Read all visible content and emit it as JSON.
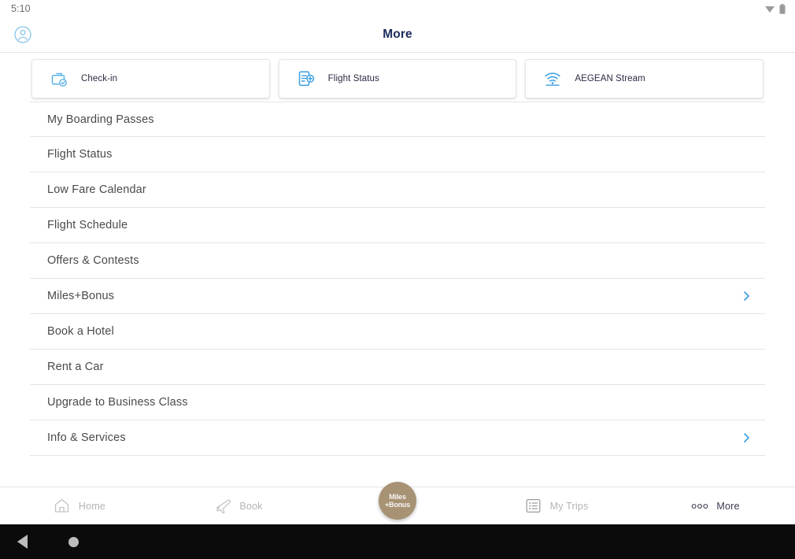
{
  "status_bar": {
    "time": "5:10",
    "icons": [
      "wifi-icon",
      "battery-icon"
    ]
  },
  "header": {
    "title": "More",
    "account_icon": "account-circle-icon"
  },
  "quick_cards": [
    {
      "label": "Check-in",
      "icon": "briefcase-check-icon"
    },
    {
      "label": "Flight Status",
      "icon": "document-plus-icon"
    },
    {
      "label": "AEGEAN Stream",
      "icon": "wifi-stream-icon"
    }
  ],
  "menu": {
    "items": [
      {
        "label": "My Boarding Passes",
        "chevron": false
      },
      {
        "label": "Flight Status",
        "chevron": false
      },
      {
        "label": "Low Fare Calendar",
        "chevron": false
      },
      {
        "label": "Flight Schedule",
        "chevron": false
      },
      {
        "label": "Offers & Contests",
        "chevron": false
      },
      {
        "label": "Miles+Bonus",
        "chevron": true
      },
      {
        "label": "Book a Hotel",
        "chevron": false
      },
      {
        "label": "Rent a Car",
        "chevron": false
      },
      {
        "label": "Upgrade to Business Class",
        "chevron": false
      },
      {
        "label": "Info & Services",
        "chevron": true
      }
    ]
  },
  "bottom_nav": {
    "items": [
      {
        "label": "Home",
        "icon": "home-icon",
        "active": false
      },
      {
        "label": "Book",
        "icon": "plane-icon",
        "active": false
      },
      {
        "label": "My Trips",
        "icon": "list-icon",
        "active": false
      },
      {
        "label": "More",
        "icon": "dots-icon",
        "active": true
      }
    ],
    "fab": {
      "line1": "Miles",
      "line2": "+Bonus",
      "color": "#a79274"
    }
  },
  "android_nav": {
    "back": "back-triangle-icon",
    "home": "home-circle-icon"
  },
  "colors": {
    "accent_blue": "#4aa3df",
    "title_navy": "#1b2a5b",
    "list_text": "#4a4a4a",
    "fab_tan": "#a79274"
  }
}
